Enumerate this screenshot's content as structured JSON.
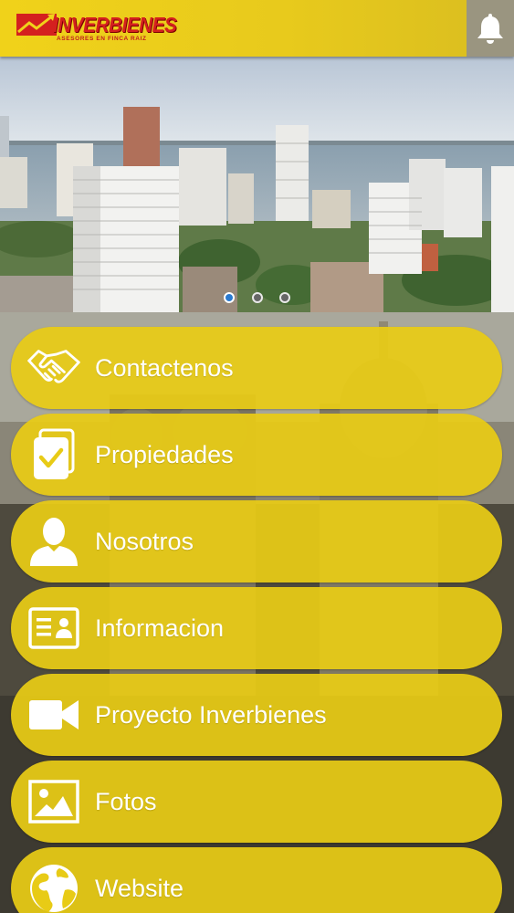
{
  "header": {
    "logo_text": "INVERBIENES",
    "logo_tagline": "ASESORES EN FINCA RAIZ",
    "bell_icon": "bell-icon"
  },
  "carousel": {
    "slide_count": 3,
    "active_index": 0
  },
  "menu": [
    {
      "label": "Contactenos",
      "icon": "handshake-icon"
    },
    {
      "label": "Propiedades",
      "icon": "document-check-icon"
    },
    {
      "label": "Nosotros",
      "icon": "user-icon"
    },
    {
      "label": "Informacion",
      "icon": "id-card-icon"
    },
    {
      "label": "Proyecto Inverbienes",
      "icon": "video-camera-icon"
    },
    {
      "label": "Fotos",
      "icon": "image-icon"
    },
    {
      "label": "Website",
      "icon": "globe-icon"
    }
  ],
  "colors": {
    "accent_yellow": "#E8CB16",
    "logo_red": "#D4201F",
    "carousel_active": "#2A7AD0"
  }
}
